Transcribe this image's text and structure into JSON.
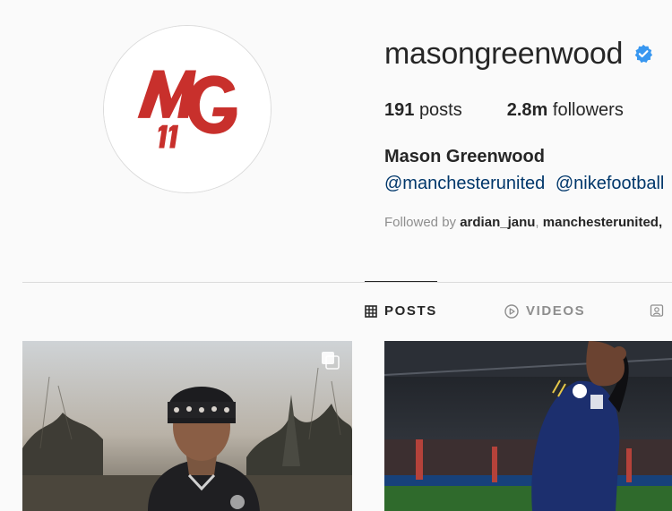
{
  "profile": {
    "username": "masongreenwood",
    "verified": true,
    "avatar": {
      "logo_text": "MG",
      "number": "11",
      "brand_color": "#c8302c"
    },
    "stats": [
      {
        "count": "191",
        "label": "posts"
      },
      {
        "count": "2.8m",
        "label": "followers"
      }
    ],
    "full_name": "Mason Greenwood",
    "mentions": [
      "@manchesterunited",
      "@nikefootball"
    ],
    "followed_by": {
      "prefix": "Followed by",
      "users": [
        "ardian_janu",
        "manchesterunited,"
      ],
      "separator": ","
    }
  },
  "tabs": [
    {
      "label": "POSTS",
      "icon": "grid-icon",
      "active": true
    },
    {
      "label": "VIDEOS",
      "icon": "play-circle-icon",
      "active": false
    },
    {
      "label": "",
      "icon": "tagged-portrait-icon",
      "active": false
    }
  ],
  "posts": [
    {
      "type": "carousel",
      "icon": "multiple-photos-icon"
    },
    {
      "type": "photo"
    }
  ],
  "colors": {
    "link": "#00376b",
    "verified": "#3897f0",
    "muted": "#8e8e8e",
    "text": "#262626"
  }
}
